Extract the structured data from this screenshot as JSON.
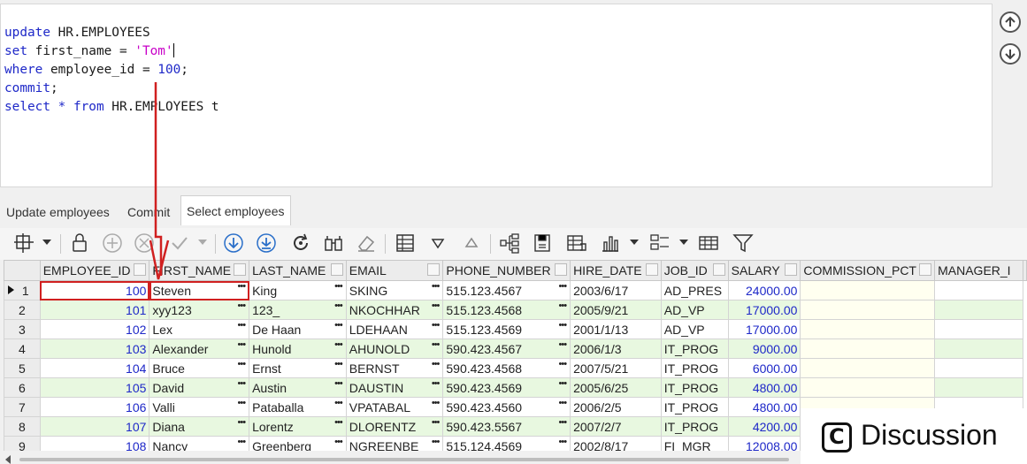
{
  "editor": {
    "lines": [
      [
        {
          "t": "update",
          "c": "kw"
        },
        {
          "t": " HR.EMPLOYEES",
          "c": ""
        }
      ],
      [
        {
          "t": "set",
          "c": "kw"
        },
        {
          "t": " first_name = ",
          "c": ""
        },
        {
          "t": "'Tom'",
          "c": "str"
        },
        {
          "t": "|caret|",
          "c": "caret"
        }
      ],
      [
        {
          "t": "where",
          "c": "kw"
        },
        {
          "t": " employee_id = ",
          "c": ""
        },
        {
          "t": "100",
          "c": "num"
        },
        {
          "t": ";",
          "c": ""
        }
      ],
      [
        {
          "t": "commit",
          "c": "kw"
        },
        {
          "t": ";",
          "c": ""
        }
      ],
      [
        {
          "t": "select",
          "c": "kw"
        },
        {
          "t": " * ",
          "c": "kw"
        },
        {
          "t": "from",
          "c": "kw"
        },
        {
          "t": " HR.EMPLOYEES t",
          "c": ""
        }
      ]
    ]
  },
  "tabs": [
    {
      "label": "Update employees",
      "active": false
    },
    {
      "label": "Commit",
      "active": false
    },
    {
      "label": "Select employees",
      "active": true
    }
  ],
  "grid": {
    "columns": [
      "EMPLOYEE_ID",
      "FIRST_NAME",
      "LAST_NAME",
      "EMAIL",
      "PHONE_NUMBER",
      "HIRE_DATE",
      "JOB_ID",
      "SALARY",
      "COMMISSION_PCT",
      "MANAGER_I"
    ],
    "rows": [
      [
        "1",
        "100",
        "Steven",
        "King",
        "SKING",
        "515.123.4567",
        "2003/6/17",
        "AD_PRES",
        "24000.00",
        "",
        ""
      ],
      [
        "2",
        "101",
        "xyy123",
        "123_",
        "NKOCHHAR",
        "515.123.4568",
        "2005/9/21",
        "AD_VP",
        "17000.00",
        "",
        ""
      ],
      [
        "3",
        "102",
        "Lex",
        "De Haan",
        "LDEHAAN",
        "515.123.4569",
        "2001/1/13",
        "AD_VP",
        "17000.00",
        "",
        ""
      ],
      [
        "4",
        "103",
        "Alexander",
        "Hunold",
        "AHUNOLD",
        "590.423.4567",
        "2006/1/3",
        "IT_PROG",
        "9000.00",
        "",
        ""
      ],
      [
        "5",
        "104",
        "Bruce",
        "Ernst",
        "BERNST",
        "590.423.4568",
        "2007/5/21",
        "IT_PROG",
        "6000.00",
        "",
        ""
      ],
      [
        "6",
        "105",
        "David",
        "Austin",
        "DAUSTIN",
        "590.423.4569",
        "2005/6/25",
        "IT_PROG",
        "4800.00",
        "",
        ""
      ],
      [
        "7",
        "106",
        "Valli",
        "Pataballa",
        "VPATABAL",
        "590.423.4560",
        "2006/2/5",
        "IT_PROG",
        "4800.00",
        "",
        ""
      ],
      [
        "8",
        "107",
        "Diana",
        "Lorentz",
        "DLORENTZ",
        "590.423.5567",
        "2007/2/7",
        "IT_PROG",
        "4200.00",
        "",
        ""
      ],
      [
        "9",
        "108",
        "Nancy",
        "Greenberg",
        "NGREENBE",
        "515.124.4569",
        "2002/8/17",
        "FI_MGR",
        "12008.00",
        "",
        ""
      ]
    ]
  },
  "badge": {
    "text": "Discussion",
    "logo": "C"
  },
  "colors": {
    "keyword": "#1e28c8",
    "string": "#c800c8",
    "altRow": "#e8f8e0",
    "annotation": "#d02020"
  }
}
